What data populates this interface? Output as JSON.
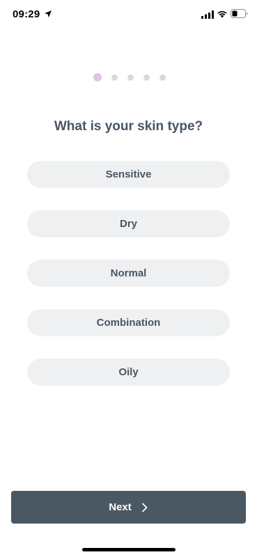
{
  "status_bar": {
    "time": "09:29",
    "icons": [
      "location-arrow-icon",
      "cellular-signal-icon",
      "wifi-icon",
      "battery-icon"
    ]
  },
  "progress": {
    "current_step": 1,
    "total_steps": 5,
    "active_color": "#e8c2de",
    "inactive_color": "#d6dadd"
  },
  "question": {
    "text": "What is your skin type?"
  },
  "options": [
    {
      "label": "Sensitive"
    },
    {
      "label": "Dry"
    },
    {
      "label": "Normal"
    },
    {
      "label": "Combination"
    },
    {
      "label": "Oily"
    }
  ],
  "next_button": {
    "label": "Next",
    "icon": "chevron-right-icon",
    "color": "#4a5864"
  },
  "colors": {
    "text": "#475564",
    "option_bg": "#eff0f1"
  }
}
